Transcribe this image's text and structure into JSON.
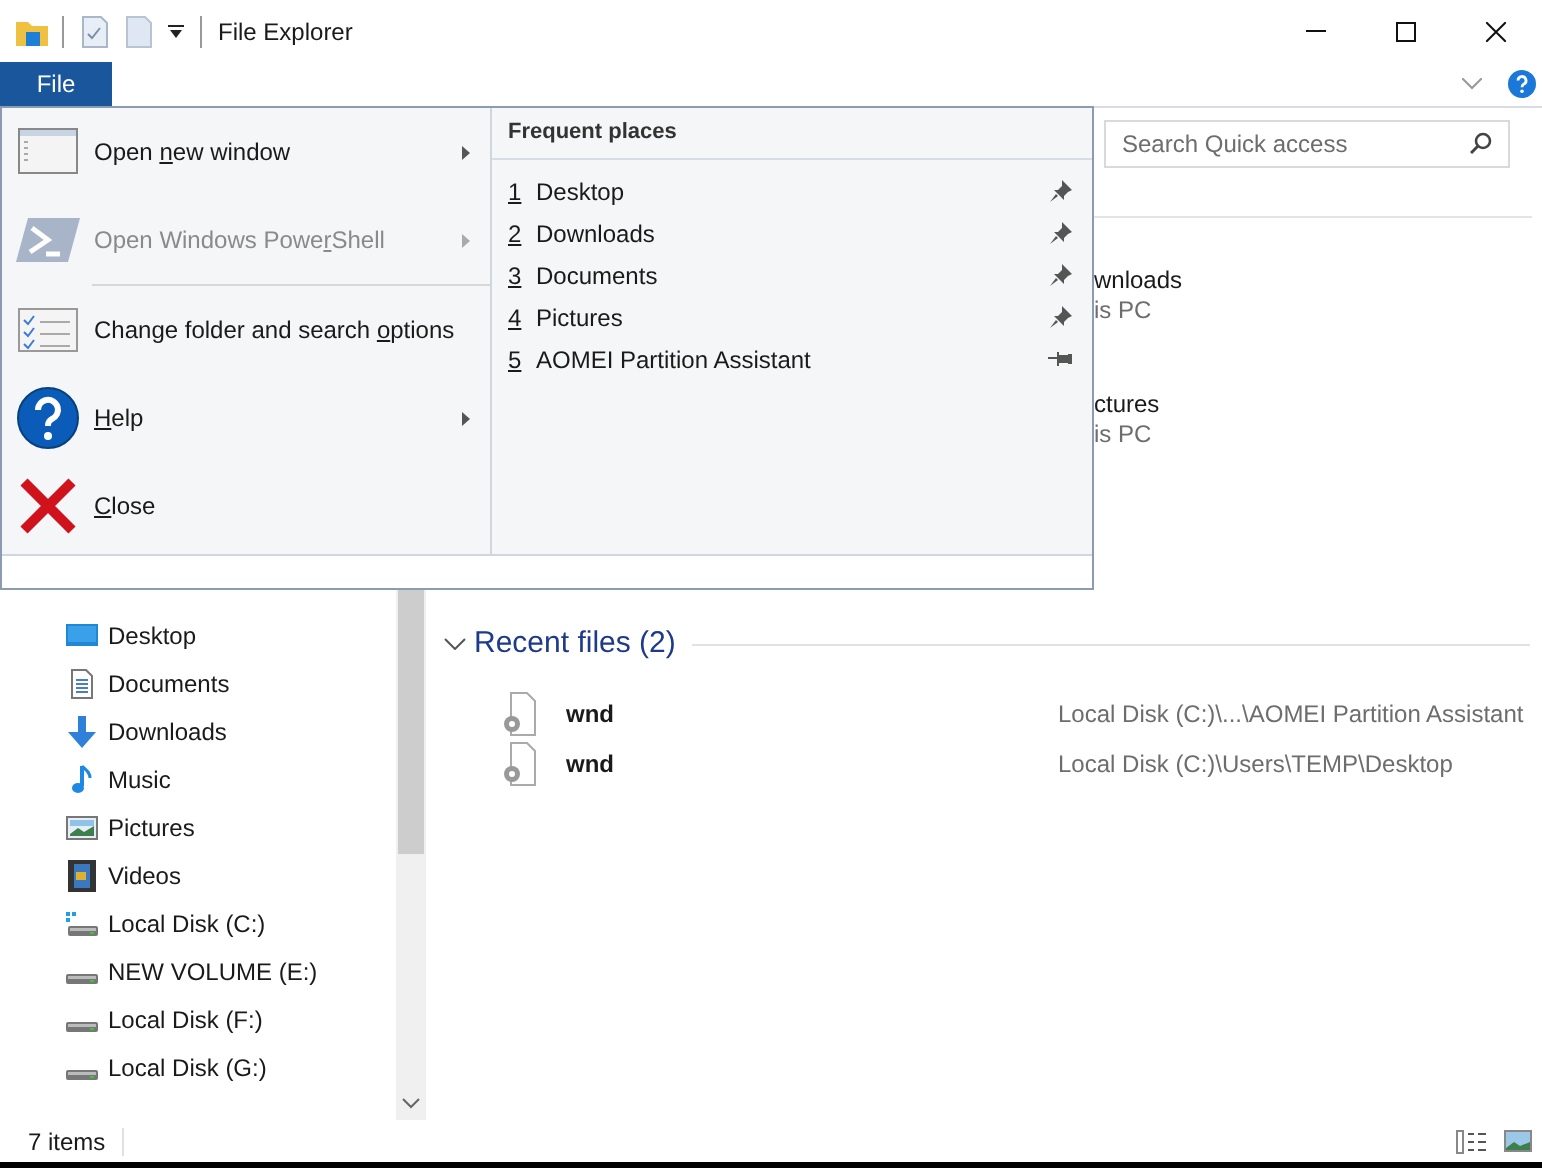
{
  "window": {
    "title": "File Explorer"
  },
  "ribbon": {
    "file_tab": "File"
  },
  "file_menu": {
    "items": [
      {
        "kind": "window",
        "label": {
          "before": "Open ",
          "key": "n",
          "after": "ew window"
        },
        "disabled": false,
        "submenu": true
      },
      {
        "kind": "powershell",
        "label": {
          "before": "Open Windows Powe",
          "key": "r",
          "after": "Shell"
        },
        "disabled": true,
        "submenu": true
      },
      {
        "kind": "options",
        "label": {
          "before": "Change folder and search ",
          "key": "o",
          "after": "ptions"
        },
        "disabled": false,
        "submenu": false
      },
      {
        "kind": "help",
        "label": {
          "key": "H",
          "after": "elp"
        },
        "disabled": false,
        "submenu": true
      },
      {
        "kind": "close",
        "label": {
          "key": "C",
          "after": "lose"
        },
        "disabled": false,
        "submenu": false
      }
    ],
    "frequent_places": {
      "title": "Frequent places",
      "items": [
        {
          "number": "1",
          "name": "Desktop",
          "pinned": true
        },
        {
          "number": "2",
          "name": "Downloads",
          "pinned": true
        },
        {
          "number": "3",
          "name": "Documents",
          "pinned": true
        },
        {
          "number": "4",
          "name": "Pictures",
          "pinned": true
        },
        {
          "number": "5",
          "name": "AOMEI Partition Assistant",
          "pinned": false
        }
      ]
    }
  },
  "search": {
    "placeholder": "Search Quick access"
  },
  "quick_access_partial": [
    {
      "name": "wnloads",
      "location": "is PC"
    },
    {
      "name": "ctures",
      "location": "is PC"
    }
  ],
  "navigation": {
    "items": [
      {
        "kind": "desktop",
        "label": "Desktop"
      },
      {
        "kind": "documents",
        "label": "Documents"
      },
      {
        "kind": "downloads",
        "label": "Downloads"
      },
      {
        "kind": "music",
        "label": "Music"
      },
      {
        "kind": "pictures",
        "label": "Pictures"
      },
      {
        "kind": "videos",
        "label": "Videos"
      },
      {
        "kind": "system_drive",
        "label": "Local Disk (C:)"
      },
      {
        "kind": "drive",
        "label": "NEW VOLUME (E:)"
      },
      {
        "kind": "drive",
        "label": "Local Disk (F:)"
      },
      {
        "kind": "drive",
        "label": "Local Disk (G:)"
      }
    ]
  },
  "recent_files": {
    "title": "Recent files (2)",
    "expanded": true,
    "items": [
      {
        "name": "wnd",
        "location": "Local Disk (C:)\\...\\AOMEI Partition Assistant"
      },
      {
        "name": "wnd",
        "location": "Local Disk (C:)\\Users\\TEMP\\Desktop"
      }
    ]
  },
  "status_bar": {
    "count": "7 items"
  }
}
